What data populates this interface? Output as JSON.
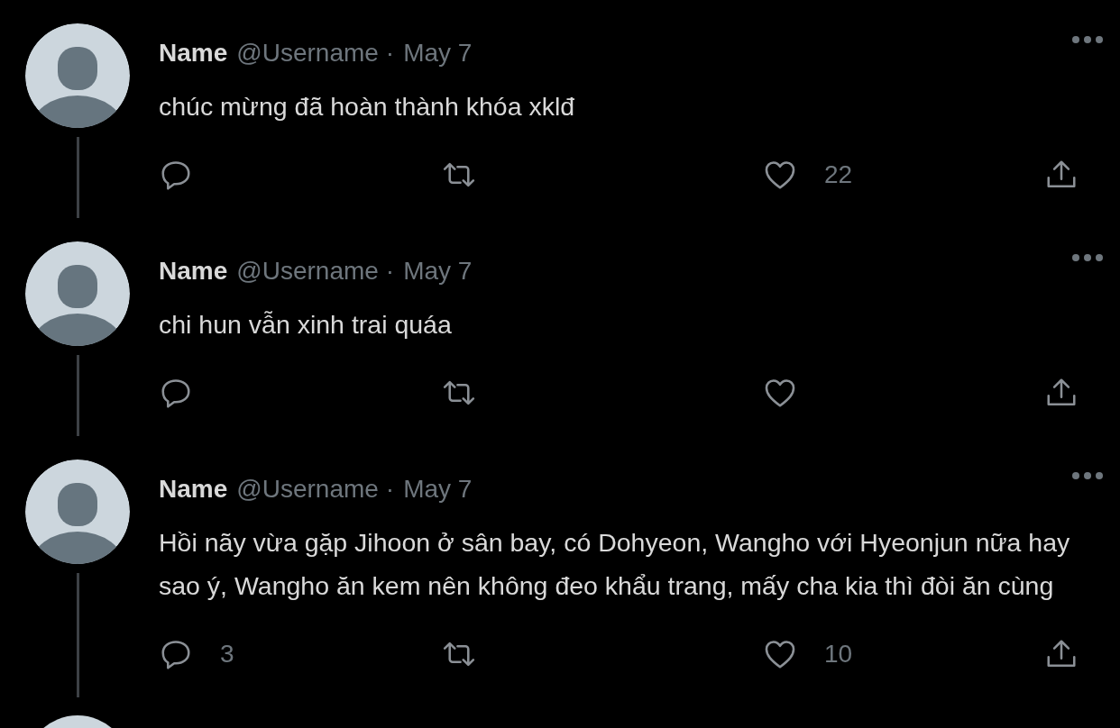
{
  "tweets": [
    {
      "name": "Name",
      "username": "@Username",
      "separator": "·",
      "date": "May 7",
      "text": "chúc mừng đã hoàn thành khóa xklđ",
      "connected": true,
      "actions": [
        {
          "kind": "reply"
        },
        {
          "kind": "retweet"
        },
        {
          "kind": "like",
          "count": "22"
        },
        {
          "kind": "share"
        }
      ]
    },
    {
      "name": "Name",
      "username": "@Username",
      "separator": "·",
      "date": "May 7",
      "text": "chi hun vẫn xinh trai quáa",
      "connected": true,
      "actions": [
        {
          "kind": "reply"
        },
        {
          "kind": "retweet"
        },
        {
          "kind": "like"
        },
        {
          "kind": "share"
        }
      ]
    },
    {
      "name": "Name",
      "username": "@Username",
      "separator": "·",
      "date": "May 7",
      "text": "Hồi nãy vừa gặp Jihoon ở sân bay, có Dohyeon, Wangho với Hyeonjun nữa hay sao ý, Wangho ăn kem nên không đeo khẩu trang, mấy cha kia thì đòi ăn cùng",
      "connected": true,
      "actions": [
        {
          "kind": "reply",
          "count": "3"
        },
        {
          "kind": "retweet"
        },
        {
          "kind": "like",
          "count": "10"
        },
        {
          "kind": "share"
        }
      ]
    }
  ]
}
